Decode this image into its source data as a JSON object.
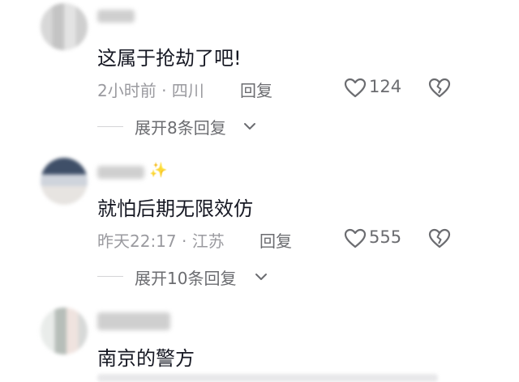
{
  "comments": [
    {
      "text": "这属于抢劫了吧!",
      "meta": "2小时前 · 四川",
      "reply_label": "回复",
      "likes": "124",
      "expand_label": "展开8条回复"
    },
    {
      "text": "就怕后期无限效仿",
      "meta": "昨天22:17 · 江苏",
      "reply_label": "回复",
      "likes": "555",
      "expand_label": "展开10条回复"
    },
    {
      "text": "南京的警方"
    }
  ],
  "icons": {
    "like": "heart-outline-icon",
    "dislike": "broken-heart-icon",
    "expand": "chevron-down-icon",
    "sparkle": "sparkle-icon"
  },
  "colors": {
    "text": "#161823",
    "meta": "#9a9a9f",
    "secondary": "#6b6c70"
  }
}
